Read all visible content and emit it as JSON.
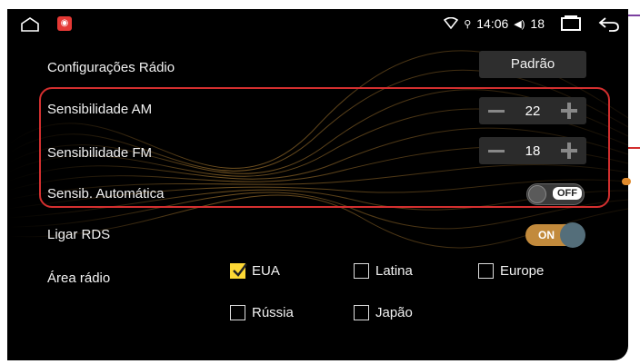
{
  "statusbar": {
    "time": "14:06",
    "volume": "18"
  },
  "settings": {
    "title": "Configurações Rádio",
    "default_button": "Padrão",
    "am_label": "Sensibilidade AM",
    "am_value": "22",
    "fm_label": "Sensibilidade FM",
    "fm_value": "18",
    "auto_label": "Sensib. Automática",
    "auto_state": "OFF",
    "rds_label": "Ligar RDS",
    "rds_state": "ON",
    "area_label": "Área rádio"
  },
  "regions": [
    {
      "label": "EUA",
      "checked": true
    },
    {
      "label": "Latina",
      "checked": false
    },
    {
      "label": "Europe",
      "checked": false
    },
    {
      "label": "Rússia",
      "checked": false
    },
    {
      "label": "Japão",
      "checked": false
    }
  ],
  "colors": {
    "highlight_border": "#d32f2f",
    "accent_on": "#c28a3c",
    "check_fill": "#fdd835"
  }
}
